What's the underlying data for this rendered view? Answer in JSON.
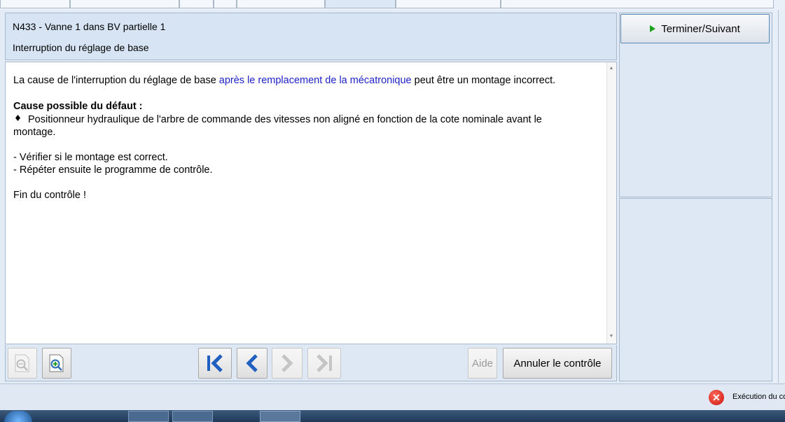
{
  "header": {
    "title": "N433 - Vanne 1 dans BV partielle 1",
    "subtitle": "Interruption du réglage de base"
  },
  "content": {
    "intro_before": "La cause de l'interruption du réglage de base ",
    "intro_link": "après le remplacement de la mécatronique",
    "intro_after": " peut être un montage incorrect.",
    "cause_heading": "Cause possible du défaut :",
    "bullet_line1": "Positionneur hydraulique de l'arbre de commande des vitesses non aligné en fonction de la cote nominale avant le",
    "bullet_line2": "montage.",
    "step1": "- Vérifier si le montage est correct.",
    "step2": "- Répéter ensuite le programme de contrôle.",
    "end": "Fin du contrôle !"
  },
  "toolbar": {
    "help_label": "Aide",
    "cancel_label": "Annuler le contrôle",
    "nav_color": "#1f5fbf"
  },
  "right": {
    "next_label": "Terminer/Suivant"
  },
  "status": {
    "text": "Exécution du co"
  }
}
